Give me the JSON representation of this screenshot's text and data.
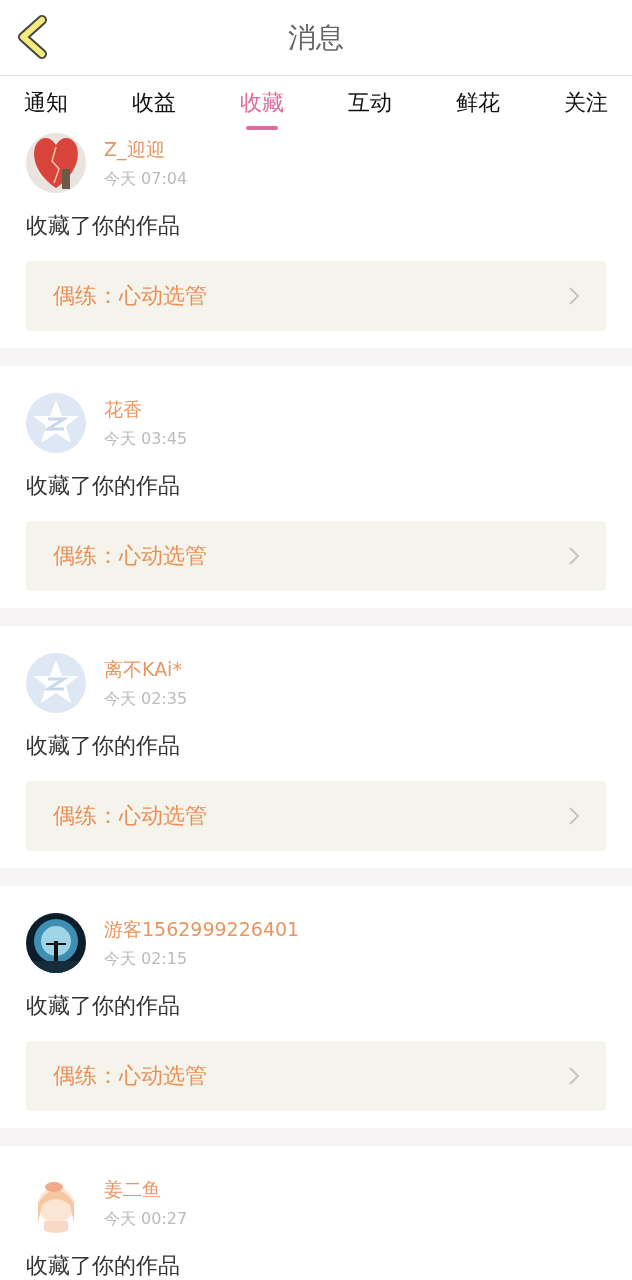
{
  "header": {
    "title": "消息"
  },
  "tabs": [
    {
      "label": "通知",
      "selected": false
    },
    {
      "label": "收益",
      "selected": false
    },
    {
      "label": "收藏",
      "selected": true
    },
    {
      "label": "互动",
      "selected": false
    },
    {
      "label": "鲜花",
      "selected": false
    },
    {
      "label": "关注",
      "selected": false
    }
  ],
  "messages": [
    {
      "avatar": {
        "kind": "photo-heart"
      },
      "name": "Z_迎迎",
      "time": "今天 07:04",
      "text": "收藏了你的作品",
      "work": "偶练：心动选管"
    },
    {
      "avatar": {
        "kind": "default"
      },
      "name": "花香",
      "time": "今天 03:45",
      "text": "收藏了你的作品",
      "work": "偶练：心动选管"
    },
    {
      "avatar": {
        "kind": "default"
      },
      "name": "离不KAi*",
      "time": "今天 02:35",
      "text": "收藏了你的作品",
      "work": "偶练：心动选管"
    },
    {
      "avatar": {
        "kind": "photo-moon"
      },
      "name": "游客1562999226401",
      "time": "今天 02:15",
      "text": "收藏了你的作品",
      "work": "偶练：心动选管"
    },
    {
      "avatar": {
        "kind": "photo-sketch"
      },
      "name": "姜二鱼",
      "time": "今天 00:27",
      "text": "收藏了你的作品"
    }
  ]
}
